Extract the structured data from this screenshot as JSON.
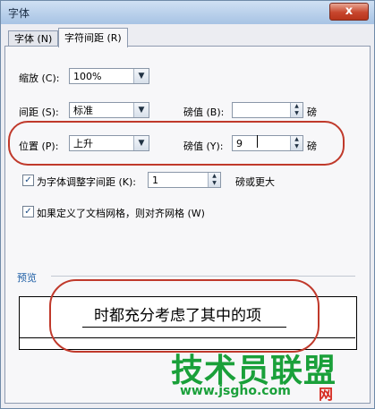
{
  "window": {
    "title": "字体",
    "close_label": "x"
  },
  "tabs": [
    {
      "label": "字体 (N)"
    },
    {
      "label": "字符间距 (R)"
    }
  ],
  "scale": {
    "label": "缩放 (C):",
    "value": "100%"
  },
  "spacing": {
    "label": "间距 (S):",
    "value": "标准",
    "amount_label": "磅值 (B):",
    "amount_value": "",
    "unit": "磅"
  },
  "position": {
    "label": "位置 (P):",
    "value": "上升",
    "amount_label": "磅值 (Y):",
    "amount_value": "9",
    "unit": "磅"
  },
  "kerning": {
    "label": "为字体调整字间距 (K):",
    "value": "1",
    "suffix": "磅或更大",
    "checked": true
  },
  "grid": {
    "label": "如果定义了文档网格，则对齐网格 (W)",
    "checked": true
  },
  "preview": {
    "label": "预览",
    "text": "时都充分考虑了其中的项"
  },
  "watermark": {
    "brand": "技术员联盟",
    "url": "www.jsgho.com",
    "extra": "网"
  },
  "colors": {
    "highlight": "#c0392b",
    "watermark": "#1aa03a"
  }
}
